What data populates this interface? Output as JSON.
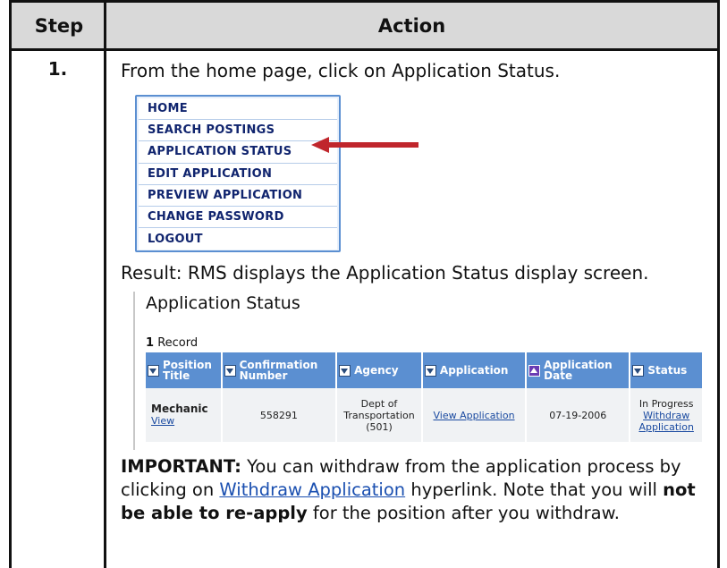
{
  "header": {
    "step": "Step",
    "action": "Action"
  },
  "step_number": "1.",
  "instruction": "From the home page, click on Application Status.",
  "menu": {
    "items": [
      "HOME",
      "SEARCH POSTINGS",
      "APPLICATION STATUS",
      "EDIT APPLICATION",
      "PREVIEW APPLICATION",
      "CHANGE PASSWORD",
      "LOGOUT"
    ]
  },
  "colors": {
    "menu_border": "#5b8fd1",
    "arrow": "#c0262c",
    "grid_header": "#5b8fd1",
    "link": "#1a4aa0"
  },
  "result": "Result: RMS displays the Application Status display screen.",
  "app_status": {
    "title": "Application Status",
    "record_count": "1",
    "record_label": "Record",
    "columns": [
      "Position Title",
      "Confirmation Number",
      "Agency",
      "Application",
      "Application Date",
      "Status"
    ],
    "row": {
      "position": "Mechanic",
      "position_link": "View",
      "confirmation": "558291",
      "agency": "Dept of Transportation (501)",
      "application_link": "View Application",
      "date": "07-19-2006",
      "status": "In Progress",
      "status_link": "Withdraw Application"
    }
  },
  "important": {
    "label": "IMPORTANT:",
    "text1": " You can withdraw from the application process by clicking on ",
    "link": "Withdraw Application",
    "text2": " hyperlink. Note that you will ",
    "bold": "not be able to re-apply",
    "text3": " for the position after you withdraw."
  }
}
